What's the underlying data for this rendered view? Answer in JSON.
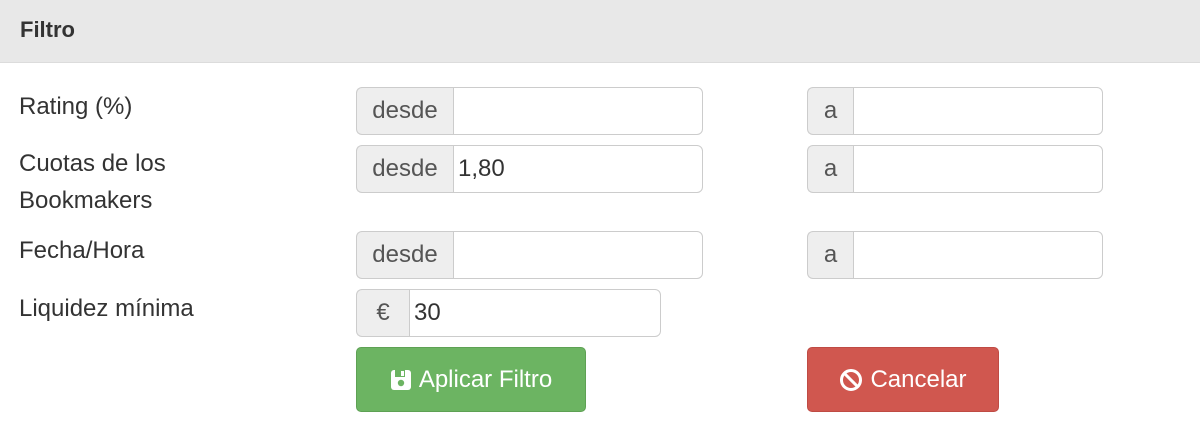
{
  "panel": {
    "title": "Filtro"
  },
  "rows": [
    {
      "label": "Rating (%)",
      "from_addon": "desde",
      "from_value": "",
      "to_addon": "a",
      "to_value": ""
    },
    {
      "label_line1": "Cuotas de los",
      "label_line2": "Bookmakers",
      "from_addon": "desde",
      "from_value": "1,80",
      "to_addon": "a",
      "to_value": ""
    },
    {
      "label": "Fecha/Hora",
      "from_addon": "desde",
      "from_value": "",
      "to_addon": "a",
      "to_value": ""
    }
  ],
  "liquidity": {
    "label": "Liquidez mínima",
    "addon": "€",
    "value": "30"
  },
  "buttons": {
    "apply": {
      "label": "Aplicar Filtro",
      "icon": "floppy-disk-icon",
      "color": "#6cb462"
    },
    "cancel": {
      "label": "Cancelar",
      "icon": "ban-icon",
      "color": "#d0574f"
    }
  }
}
